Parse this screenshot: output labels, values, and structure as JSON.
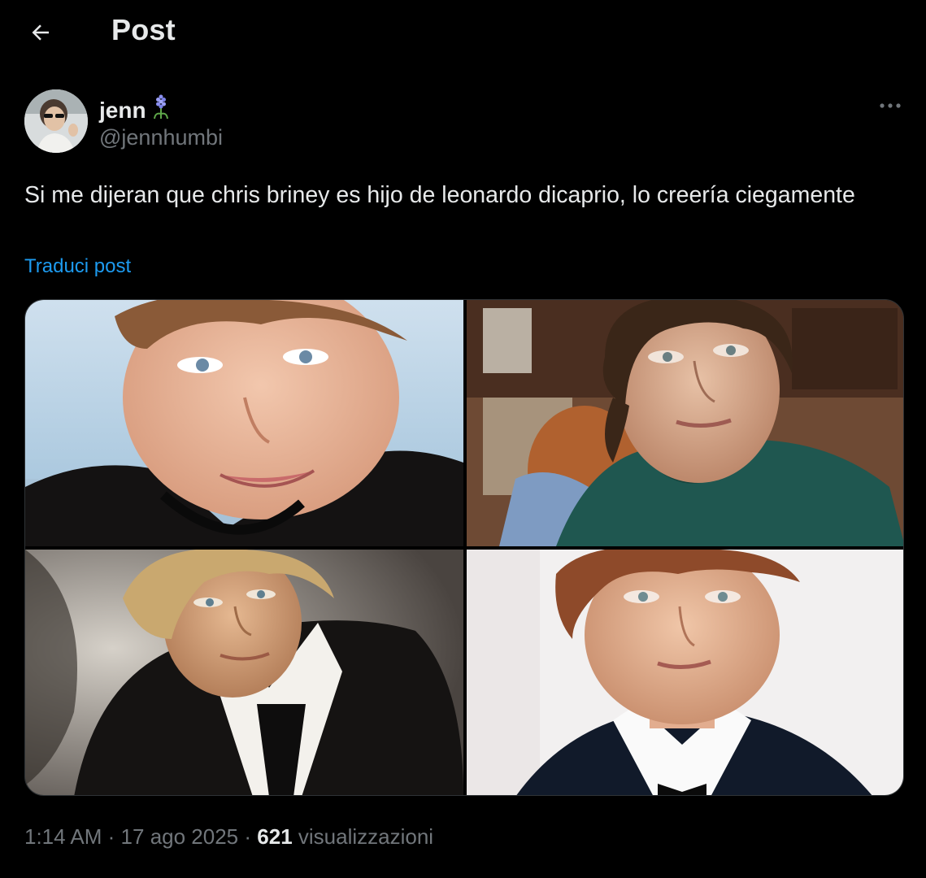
{
  "header": {
    "title": "Post"
  },
  "author": {
    "display_name": "jenn",
    "name_emoji": "hyacinth-icon",
    "handle": "@jennhumbi"
  },
  "post": {
    "text": "Si me dijeran que chris briney es hijo de leonardo dicaprio, lo creería ciegamente",
    "translate_label": "Traduci post",
    "media": [
      {
        "id": "photo-1"
      },
      {
        "id": "photo-2"
      },
      {
        "id": "photo-3"
      },
      {
        "id": "photo-4"
      }
    ]
  },
  "meta": {
    "time": "1:14 AM",
    "separator": "·",
    "date": "17 ago 2025",
    "views_count": "621",
    "views_label": "visualizzazioni"
  },
  "colors": {
    "background": "#000000",
    "text_primary": "#e7e9ea",
    "text_secondary": "#71767b",
    "link": "#1d9bf0",
    "border": "#2f3336"
  }
}
